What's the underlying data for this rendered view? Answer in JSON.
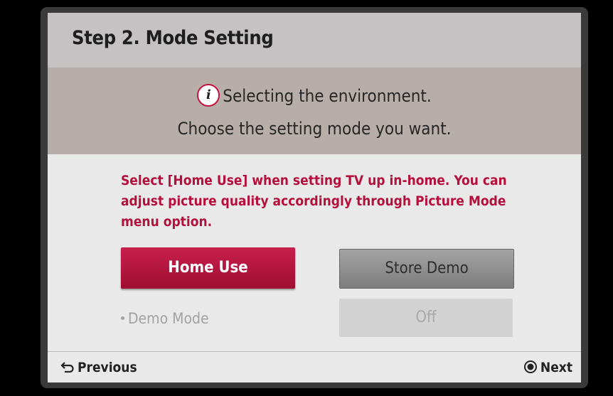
{
  "dialog": {
    "title": "Step 2. Mode Setting",
    "env_line1": "Selecting the environment.",
    "env_line2": "Choose the setting mode you want.",
    "description": "Select [Home Use] when setting TV up in-home. You can adjust picture quality accordingly through Picture Mode menu option.",
    "home_use_label": "Home Use",
    "store_demo_label": "Store Demo",
    "demo_mode_label": "Demo Mode",
    "demo_mode_value": "Off",
    "previous_label": "Previous",
    "next_label": "Next"
  },
  "icons": {
    "info": "info-icon",
    "back": "back-arrow-icon",
    "ok": "ok-button-icon"
  },
  "colors": {
    "accent": "#b5103c",
    "selected_button": "#c81f4d"
  }
}
